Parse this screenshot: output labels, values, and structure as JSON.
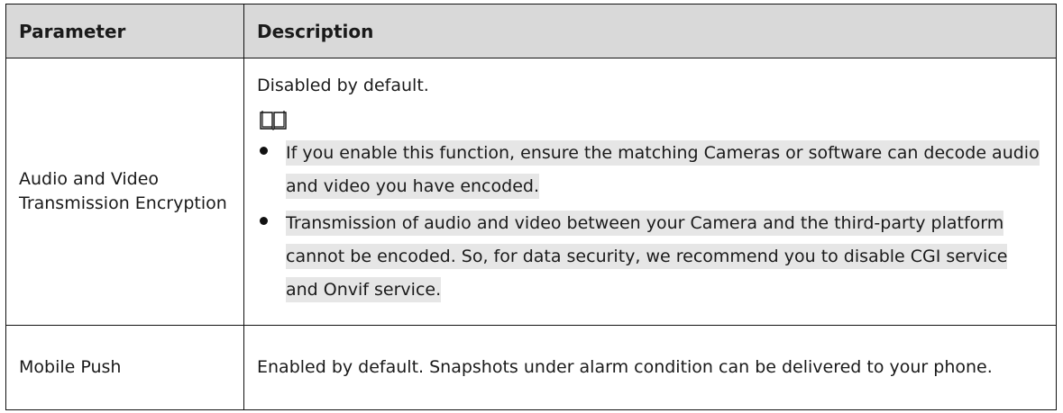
{
  "table": {
    "headers": {
      "parameter": "Parameter",
      "description": "Description"
    },
    "rows": [
      {
        "parameter": "Audio and Video Transmission Encryption",
        "description": "Disabled by default.",
        "note_icon": "book-icon",
        "bullets": [
          "If you enable this function, ensure the matching Cameras or software can decode audio and video you have encoded.",
          "Transmission of audio and video between your Camera and the third-party platform cannot be encoded. So, for data security, we recommend you to disable CGI service and Onvif service."
        ]
      },
      {
        "parameter": "Mobile Push",
        "description": "Enabled by default. Snapshots under alarm condition can be delivered to your phone."
      }
    ]
  },
  "colors": {
    "header_bg": "#d9d9d9",
    "highlight_bg": "#e6e6e6",
    "border": "#111111"
  }
}
